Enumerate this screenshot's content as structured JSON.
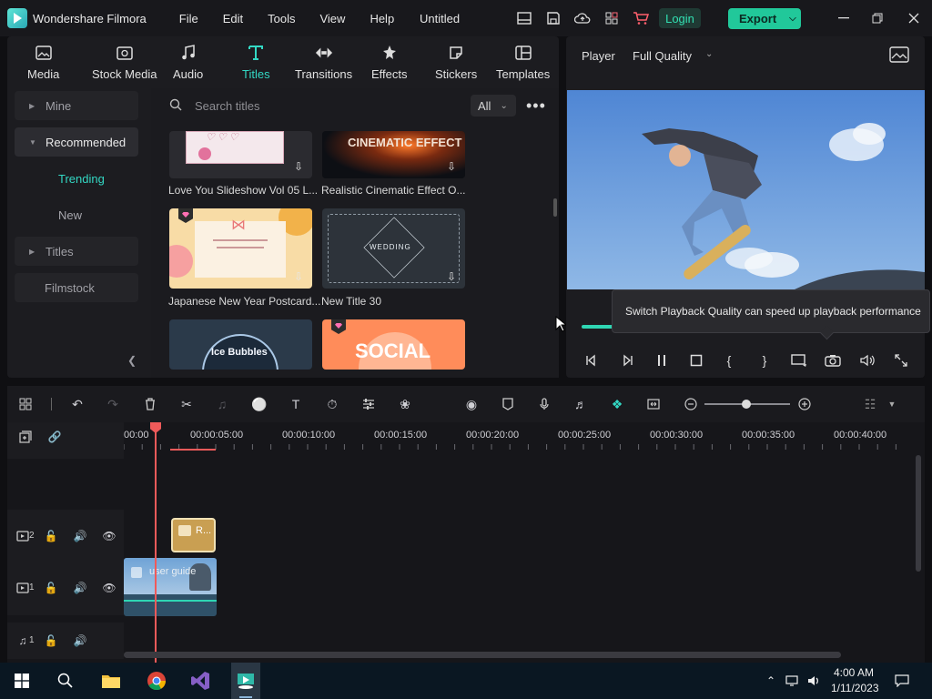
{
  "app": {
    "name": "Wondershare Filmora",
    "doc_title": "Untitled",
    "login_label": "Login",
    "export_label": "Export"
  },
  "menu": [
    "File",
    "Edit",
    "Tools",
    "View",
    "Help"
  ],
  "library_tabs": [
    {
      "label": "Media",
      "icon": "media-icon"
    },
    {
      "label": "Stock Media",
      "icon": "stock-media-icon"
    },
    {
      "label": "Audio",
      "icon": "audio-icon"
    },
    {
      "label": "Titles",
      "icon": "titles-icon",
      "active": true
    },
    {
      "label": "Transitions",
      "icon": "transitions-icon"
    },
    {
      "label": "Effects",
      "icon": "effects-icon"
    },
    {
      "label": "Stickers",
      "icon": "stickers-icon"
    },
    {
      "label": "Templates",
      "icon": "templates-icon"
    }
  ],
  "sidebar": {
    "mine": "Mine",
    "recommended": "Recommended",
    "trending": "Trending",
    "new": "New",
    "titles": "Titles",
    "filmstock": "Filmstock"
  },
  "search": {
    "placeholder": "Search titles",
    "filter": "All"
  },
  "thumbnails": [
    {
      "label": "Love You Slideshow Vol 05 L...",
      "text": ""
    },
    {
      "label": "Realistic Cinematic Effect O...",
      "text": "CINEMATIC EFFECT"
    },
    {
      "label": "Japanese New Year Postcard...",
      "text": ""
    },
    {
      "label": "New Title 30",
      "text": "WEDDING"
    },
    {
      "label": "",
      "text": "Ice Bubbles"
    },
    {
      "label": "",
      "text": "SOCIAL"
    }
  ],
  "player": {
    "label": "Player",
    "quality": "Full Quality",
    "tooltip": "Switch Playback Quality can speed up playback performance"
  },
  "ruler": [
    "00:00",
    "00:00:05:00",
    "00:00:10:00",
    "00:00:15:00",
    "00:00:20:00",
    "00:00:25:00",
    "00:00:30:00",
    "00:00:35:00",
    "00:00:40:00"
  ],
  "tracks": {
    "track2_num": "2",
    "track1_num": "1",
    "audio1_num": "1",
    "title_clip": "R...",
    "video_clip": "user guide"
  },
  "taskbar": {
    "time": "4:00 AM",
    "date": "1/11/2023"
  },
  "colors": {
    "accent": "#33d8c4",
    "export": "#21c89a",
    "playhead": "#ef5a5a"
  }
}
